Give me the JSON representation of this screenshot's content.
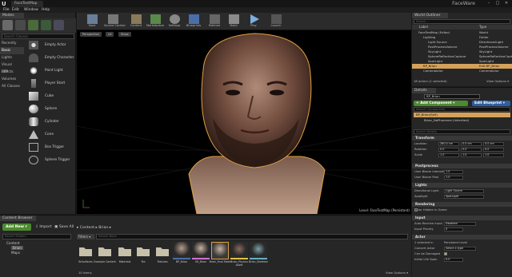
{
  "window": {
    "title": "FaceTestMap",
    "brand": "FaceWare",
    "logo": "U",
    "minimize": "–",
    "maximize": "□",
    "close": "✕"
  },
  "menu": [
    "File",
    "Edit",
    "Window",
    "Help"
  ],
  "modes": {
    "tab": "Modes",
    "search_placeholder": "Search Classes",
    "categories": [
      "Recently Placed",
      "Basic",
      "Lights",
      "Visual Effects",
      "BSP",
      "Volumes",
      "All Classes"
    ],
    "items": [
      "Empty Actor",
      "Empty Character",
      "Point Light",
      "Player Start",
      "Cube",
      "Sphere",
      "Cylinder",
      "Cone",
      "Box Trigger",
      "Sphere Trigger"
    ]
  },
  "toolbar": {
    "buttons": [
      "Save",
      "Source Control",
      "Content",
      "Marketplace",
      "Settings",
      "Blueprints",
      "Matinee",
      "Build",
      "Play",
      "Launch"
    ]
  },
  "viewport": {
    "buttons": [
      "Perspective",
      "Lit",
      "Show"
    ],
    "level_label": "Level: FaceTestMap (Persistent)"
  },
  "outliner": {
    "tab": "World Outliner",
    "search_placeholder": "Search...",
    "col_label": "Label",
    "col_type": "Type",
    "rows": [
      {
        "label": "FaceTestMap (Editor)",
        "type": "World"
      },
      {
        "label": "Lighting",
        "type": "Folder"
      },
      {
        "label": "Light Source",
        "type": "DirectionalLight"
      },
      {
        "label": "PostProcessVolume",
        "type": "PostProcessVolume"
      },
      {
        "label": "SkyLight",
        "type": "SkyLight"
      },
      {
        "label": "SphereReflectionCapture",
        "type": "SphereReflectionCapture"
      },
      {
        "label": "SpotLight",
        "type": "SpotLight"
      },
      {
        "label": "BP_Brian",
        "type": "Edit BP_Brian"
      },
      {
        "label": "CameraActor",
        "type": "CameraActor"
      }
    ],
    "count": "18 actors (1 selected)",
    "view_options": "View Options ▾"
  },
  "details": {
    "tab": "Details",
    "name_value": "BP_Brian",
    "add_component": "+ Add Component ▾",
    "edit_blueprint": "Edit Blueprint ▾",
    "search_components": "Search Components",
    "selected_component": "BP_Brian(Self)",
    "component_line": "Brian_NoPhoneme (Inherited)",
    "search_details": "Search Details",
    "sections": {
      "transform": "Transform",
      "rendering": "Rendering",
      "input": "Input",
      "actor": "Actor",
      "postprocess": "Postprocess",
      "lights": "Lights"
    },
    "props": {
      "location": "Location",
      "rotation": "Rotation",
      "scale": "Scale",
      "loc_vals": [
        "260.0 cm",
        "0.0 cm",
        "0.0 cm"
      ],
      "rot_vals": [
        "0.0",
        "0.0",
        "0.0"
      ],
      "scale_vals": [
        "1.0",
        "1.0",
        "1.0"
      ],
      "user_bloom_intensity": "User Bloom Intensity",
      "user_bloom_intensity_val": "1.0",
      "user_bloom_post": "User Bloom Post",
      "user_bloom_post_val": "1.0",
      "directional_light": "Directional Light",
      "directional_light_val": "Light Source",
      "spotlight": "Spotlight",
      "spotlight_val": "SpotLight",
      "actor_hidden": "Actor Hidden in Game",
      "auto_receive": "Auto Receive Input",
      "auto_receive_val": "Disabled",
      "input_priority": "Input Priority",
      "input_priority_val": "0",
      "selected_in": "1 selected in",
      "selected_in_val": "Persistent Level",
      "convert_actor": "Convert Actor",
      "convert_actor_val": "Select a type",
      "can_be_damaged": "Can be Damaged",
      "initial_life_span": "Initial Life Span",
      "initial_life_span_val": "0.0"
    }
  },
  "content_browser": {
    "tab": "Content Browser",
    "add_new": "Add New ▾",
    "import": "Import",
    "save_all": "Save All",
    "path": "▸ Content ▸ Brian ▸",
    "folder_search": "Search Folders",
    "tree": [
      "Content",
      "Brian",
      "Maps"
    ],
    "filters": "Filters ▾",
    "asset_search": "Search Brian",
    "assets": [
      {
        "label": "BrianFaces",
        "kind": "folder"
      },
      {
        "label": "Example Content",
        "kind": "folder"
      },
      {
        "label": "Materials",
        "kind": "folder"
      },
      {
        "label": "Tex",
        "kind": "folder"
      },
      {
        "label": "Textures",
        "kind": "folder"
      },
      {
        "label": "BP_Brian",
        "kind": "blueprint"
      },
      {
        "label": "SK_Brian",
        "kind": "mesh"
      },
      {
        "label": "Brian_Final Mesh",
        "kind": "mesh-selected"
      },
      {
        "label": "Brian_Physics Asset",
        "kind": "physics"
      },
      {
        "label": "Brian_Skeleton",
        "kind": "skeleton"
      }
    ],
    "item_count": "10 items",
    "view_options": "View Options ▾"
  },
  "colors": {
    "accent_green": "#4c8a2f",
    "accent_blue": "#2c5fa3",
    "selection": "#d4a15a"
  }
}
